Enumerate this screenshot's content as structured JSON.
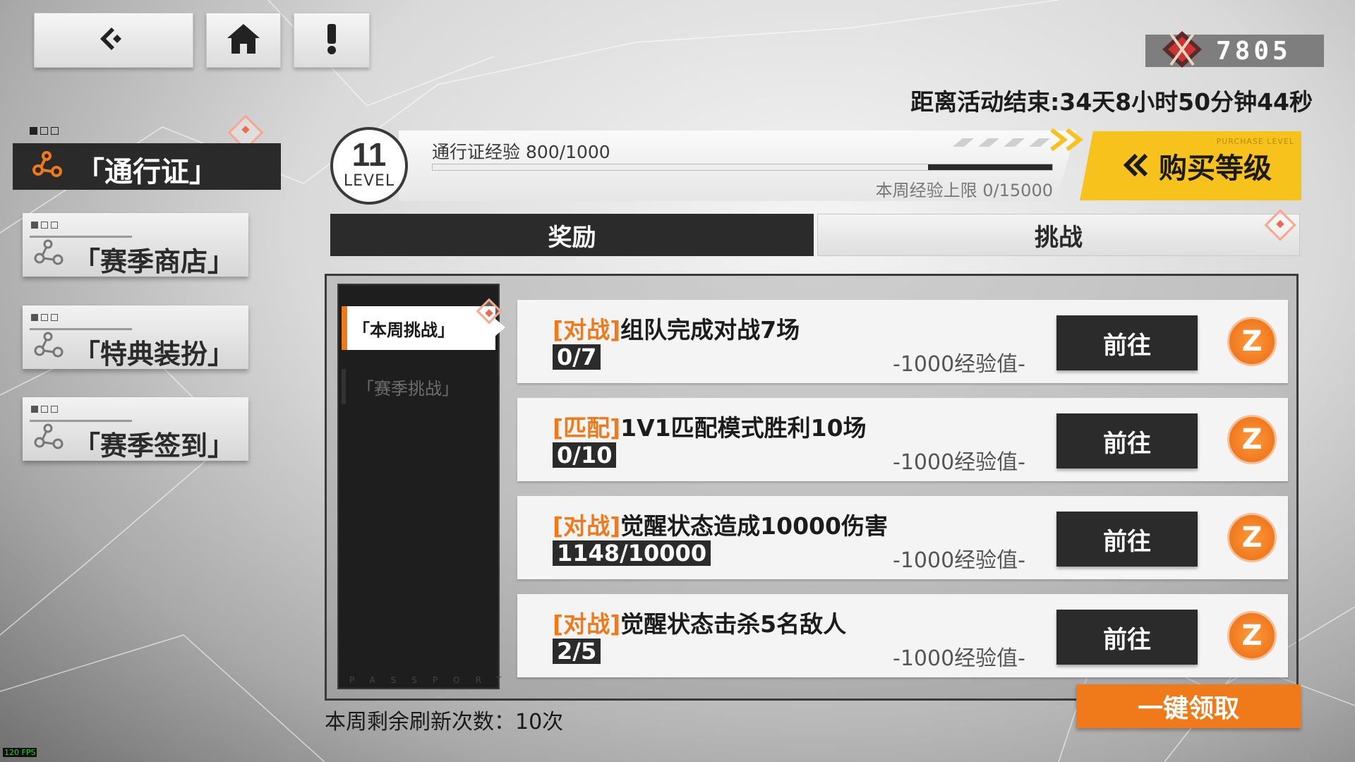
{
  "header": {
    "back_icon": "back-icon",
    "home_icon": "home-icon",
    "notice_icon": "exclamation-icon",
    "currency_value": "7805",
    "currency_icon": "emblem-icon",
    "countdown": "距离活动结束:34天8小时50分钟44秒"
  },
  "sidenav": {
    "items": [
      {
        "label": "「通行证」",
        "active": true
      },
      {
        "label": "「赛季商店」",
        "active": false
      },
      {
        "label": "「特典装扮」",
        "active": false
      },
      {
        "label": "「赛季签到」",
        "active": false
      }
    ]
  },
  "level": {
    "number": "11",
    "word": "LEVEL",
    "exp_text": "通行证经验 800/1000",
    "exp_progress": 0.8,
    "weekly_text": "本周经验上限 0/15000",
    "buy_label": "购买等级",
    "buy_tag": "PURCHASE LEVEL"
  },
  "tabs": [
    {
      "label": "奖励",
      "active": true
    },
    {
      "label": "挑战",
      "active": false
    }
  ],
  "subnav": {
    "active": "「本周挑战」",
    "inactive": "「赛季挑战」",
    "footer": "PASSPORT"
  },
  "tasks": [
    {
      "tag": "[对战]",
      "title": "组队完成对战7场",
      "progress": "0/7",
      "reward": "-1000经验值-",
      "button": "前往"
    },
    {
      "tag": "[匹配]",
      "title": "1V1匹配模式胜利10场",
      "progress": "0/10",
      "reward": "-1000经验值-",
      "button": "前往"
    },
    {
      "tag": "[对战]",
      "title": "觉醒状态造成10000伤害",
      "progress": "1148/10000",
      "reward": "-1000经验值-",
      "button": "前往"
    },
    {
      "tag": "[对战]",
      "title": "觉醒状态击杀5名敌人",
      "progress": "2/5",
      "reward": "-1000经验值-",
      "button": "前往"
    }
  ],
  "footer": {
    "refresh_text": "本周剩余刷新次数：10次",
    "claim_all": "一键领取",
    "fps": "120 FPS"
  },
  "colors": {
    "accent": "#f07a19",
    "dark": "#2b2b2b",
    "gold": "#f6c21b"
  }
}
